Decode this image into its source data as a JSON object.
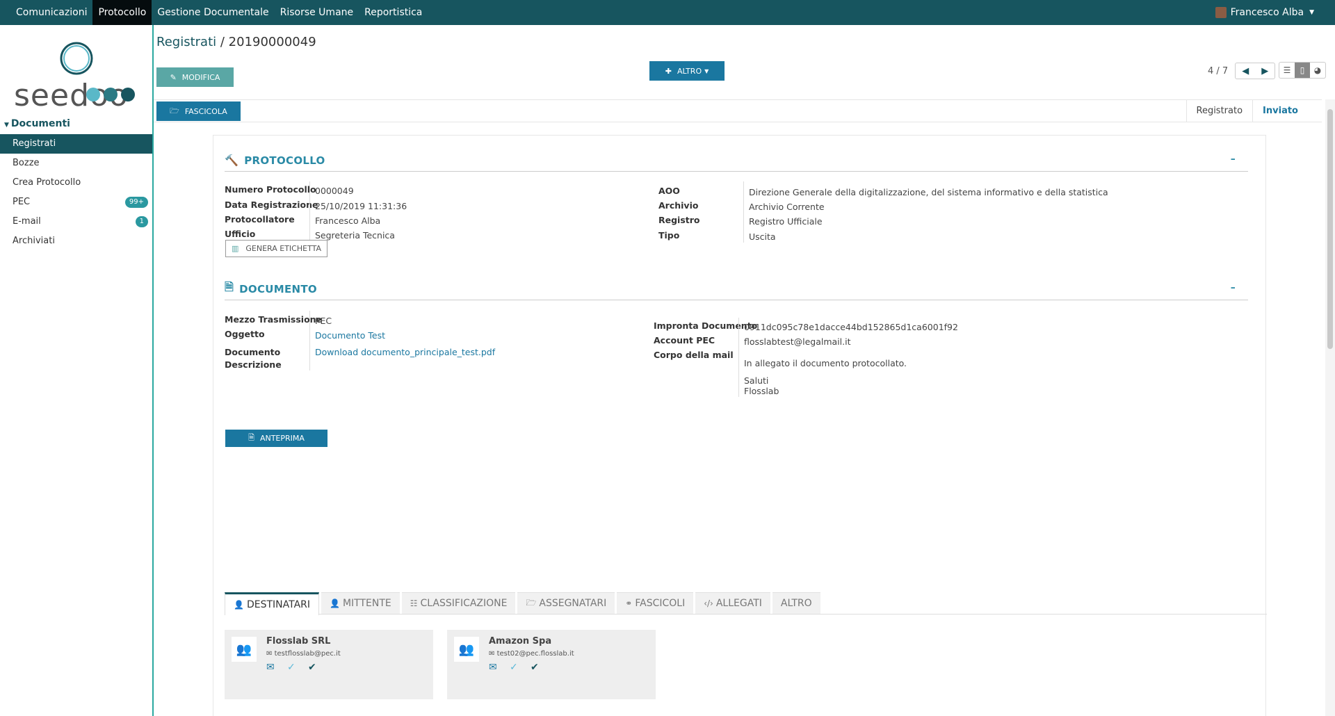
{
  "topnav": {
    "items": [
      "Comunicazioni",
      "Protocollo",
      "Gestione Documentale",
      "Risorse Umane",
      "Reportistica"
    ],
    "active_index": 1,
    "user": "Francesco Alba"
  },
  "sidebar": {
    "logo_text": "seedoo",
    "section": "Documenti",
    "items": [
      {
        "label": "Registrati",
        "badge": ""
      },
      {
        "label": "Bozze",
        "badge": ""
      },
      {
        "label": "Crea Protocollo",
        "badge": ""
      },
      {
        "label": "PEC",
        "badge": "99+"
      },
      {
        "label": "E-mail",
        "badge": "1"
      },
      {
        "label": "Archiviati",
        "badge": ""
      }
    ]
  },
  "header": {
    "breadcrumb": "Registrati",
    "separator": "/",
    "record": "20190000049",
    "modifica": "MODIFICA",
    "altro": "ALTRO",
    "pager": "4 / 7",
    "fascicola": "FASCICOLA",
    "states": [
      "Registrato",
      "Inviato"
    ]
  },
  "protocollo": {
    "title": "PROTOCOLLO",
    "collapse": "–",
    "left": [
      {
        "label": "Numero Protocollo",
        "value": "0000049"
      },
      {
        "label": "Data Registrazione",
        "value": "25/10/2019 11:31:36"
      },
      {
        "label": "Protocollatore",
        "value": "Francesco Alba"
      },
      {
        "label": "Ufficio",
        "value": "Segreteria Tecnica"
      }
    ],
    "right": [
      {
        "label": "AOO",
        "value": "Direzione Generale della digitalizzazione, del sistema informativo e della statistica"
      },
      {
        "label": "Archivio",
        "value": "Archivio Corrente"
      },
      {
        "label": "Registro",
        "value": "Registro Ufficiale"
      },
      {
        "label": "Tipo",
        "value": "Uscita"
      }
    ],
    "genera_etichetta": "GENERA ETICHETTA"
  },
  "documento": {
    "title": "DOCUMENTO",
    "collapse": "–",
    "mezzo_label": "Mezzo Trasmissione",
    "mezzo_value": "PEC",
    "oggetto_label": "Oggetto",
    "oggetto_value": "Documento Test",
    "documento_label": "Documento",
    "documento_value": "Download documento_principale_test.pdf",
    "descrizione_label": "Descrizione",
    "impronta_label": "Impronta Documento",
    "impronta_value": "0911dc095c78e1dacce44bd152865d1ca6001f92",
    "account_label": "Account PEC",
    "account_value": "flosslabtest@legalmail.it",
    "corpo_label": "Corpo della mail",
    "corpo_line1": "In allegato il documento protocollato.",
    "corpo_line2": "Saluti",
    "corpo_line3": "Flosslab",
    "anteprima": "ANTEPRIMA"
  },
  "tabs": [
    "DESTINATARI",
    "MITTENTE",
    "CLASSIFICAZIONE",
    "ASSEGNATARI",
    "FASCICOLI",
    "ALLEGATI",
    "ALTRO"
  ],
  "recipients": [
    {
      "name": "Flosslab SRL",
      "email": "testflosslab@pec.it"
    },
    {
      "name": "Amazon Spa",
      "email": "test02@pec.flosslab.it"
    }
  ],
  "colors": {
    "primary": "#17555f",
    "accent": "#1a77a0",
    "teal": "#2aa8a0"
  }
}
